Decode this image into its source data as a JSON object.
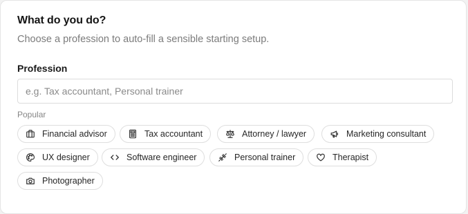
{
  "card": {
    "title": "What do you do?",
    "subtitle": "Choose a profession to auto-fill a sensible starting setup."
  },
  "profession": {
    "label": "Profession",
    "placeholder": "e.g. Tax accountant, Personal trainer",
    "value": ""
  },
  "popular": {
    "label": "Popular",
    "chips": [
      {
        "label": "Financial advisor",
        "icon": "briefcase-icon"
      },
      {
        "label": "Tax accountant",
        "icon": "calculator-icon"
      },
      {
        "label": "Attorney / lawyer",
        "icon": "scale-icon"
      },
      {
        "label": "Marketing consultant",
        "icon": "megaphone-icon"
      },
      {
        "label": "UX designer",
        "icon": "palette-icon"
      },
      {
        "label": "Software engineer",
        "icon": "code-icon"
      },
      {
        "label": "Personal trainer",
        "icon": "dumbbell-icon"
      },
      {
        "label": "Therapist",
        "icon": "heart-icon"
      },
      {
        "label": "Photographer",
        "icon": "camera-icon"
      }
    ]
  }
}
